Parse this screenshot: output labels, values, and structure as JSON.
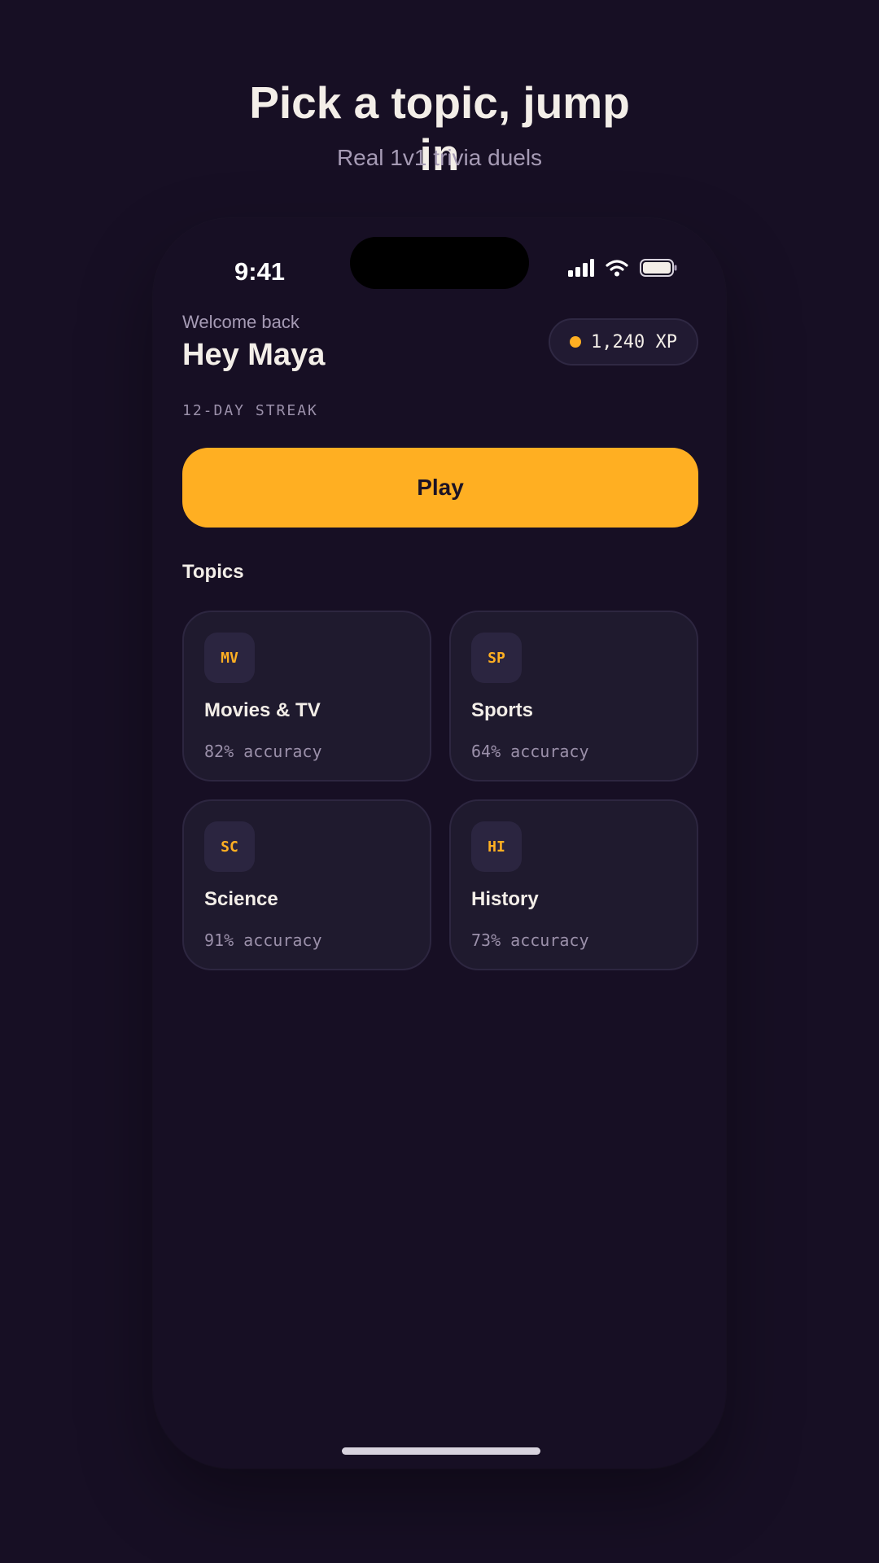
{
  "hero": {
    "title": "Pick a topic, jump in",
    "subtitle": "Real 1v1 trivia duels"
  },
  "status_bar": {
    "time": "9:41",
    "icons": [
      "signal-icon",
      "wifi-icon",
      "battery-icon"
    ]
  },
  "header": {
    "welcome_label": "Welcome back",
    "user_name": "Hey Maya",
    "xp_label": "1,240 XP",
    "streak_label": "12-DAY STREAK"
  },
  "play_button": {
    "label": "Play"
  },
  "topics": {
    "section_title": "Topics",
    "items": [
      {
        "badge": "MV",
        "name": "Movies & TV",
        "accuracy": "82% accuracy"
      },
      {
        "badge": "SP",
        "name": "Sports",
        "accuracy": "64% accuracy"
      },
      {
        "badge": "SC",
        "name": "Science",
        "accuracy": "91% accuracy"
      },
      {
        "badge": "HI",
        "name": "History",
        "accuracy": "73% accuracy"
      }
    ]
  },
  "colors": {
    "background": "#170f24",
    "accent": "#ffaf22",
    "card": "#1f1a2e",
    "text_primary": "#f3eee8",
    "text_secondary": "#a69bb5"
  }
}
